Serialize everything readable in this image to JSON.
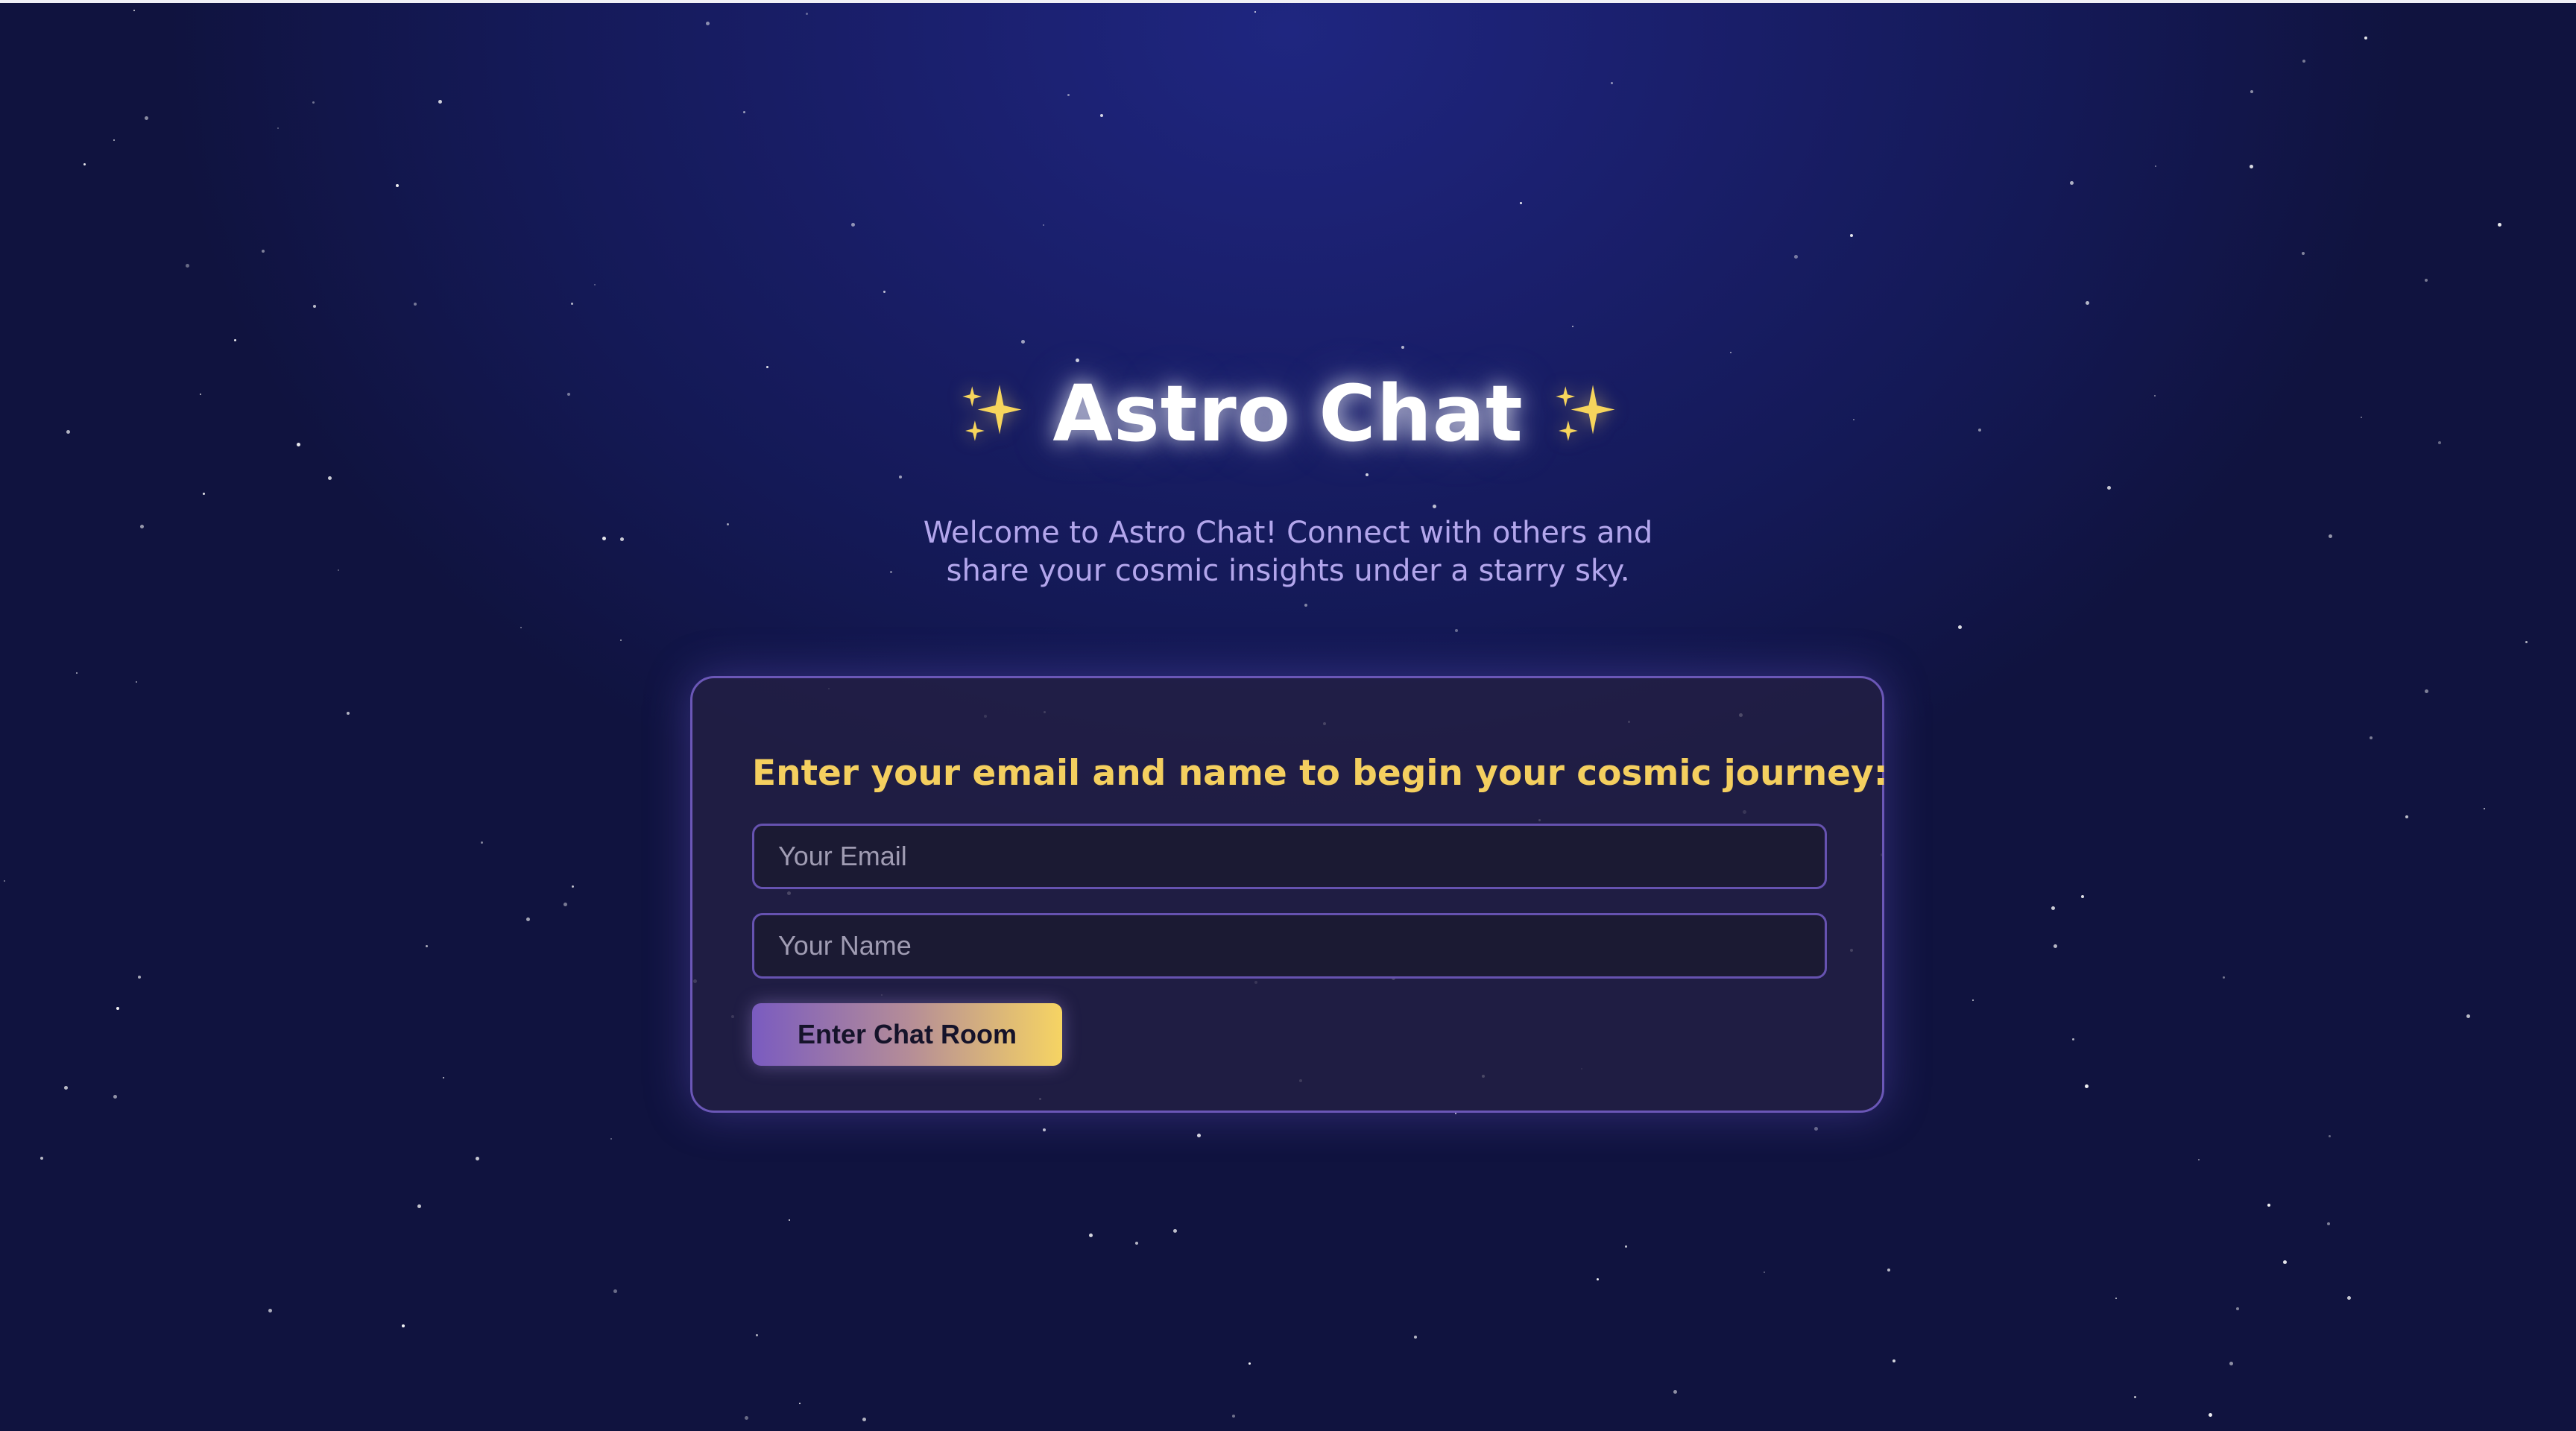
{
  "app": {
    "title": "Astro Chat",
    "title_decoration_icon": "sparkles-icon",
    "subtitle": "Welcome to Astro Chat! Connect with others and share your cosmic insights under a starry sky."
  },
  "login_form": {
    "heading": "Enter your email and name to begin your cosmic journey:",
    "email_placeholder": "Your Email",
    "email_value": "",
    "name_placeholder": "Your Name",
    "name_value": "",
    "submit_label": "Enter Chat Room"
  },
  "colors": {
    "background_top": "#1f2680",
    "background_bottom": "#10133f",
    "heading_accent": "#f4cf5f",
    "subtitle_text": "#b3a6ec",
    "card_border": "#6b57b7",
    "button_gradient_start": "#7a5bc0",
    "button_gradient_end": "#f6d463"
  }
}
